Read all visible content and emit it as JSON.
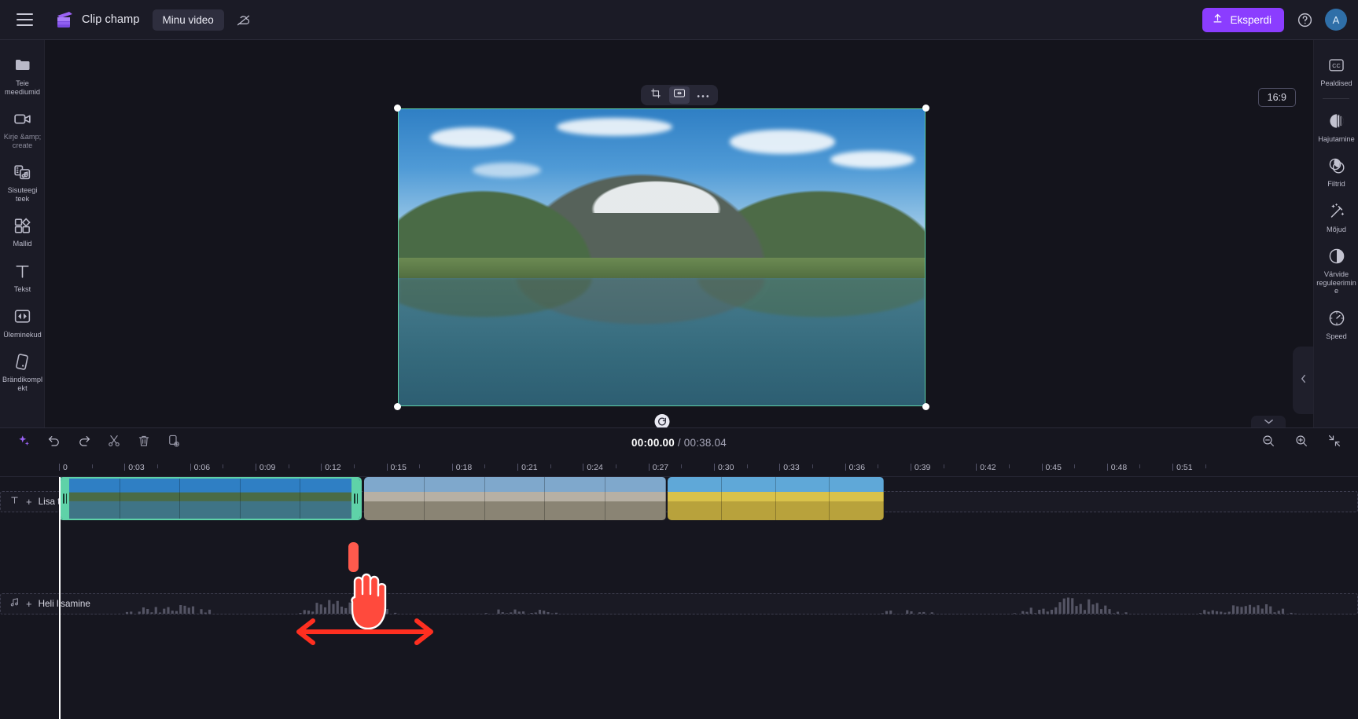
{
  "app": {
    "brand_name": "Clip champ",
    "project_name": "Minu video"
  },
  "topbar": {
    "menu_icon": "hamburger-icon",
    "logo_icon": "clipchamp-logo-icon",
    "cloud_off_icon": "cloud-off-icon",
    "export_label": "Eksperdi",
    "export_icon": "upload-icon",
    "help_icon": "help-circle-icon",
    "avatar_initial": "A",
    "accent_color": "#8b3dff"
  },
  "sidebar_left": {
    "items": [
      {
        "label": "Teie meediumid",
        "icon": "folder-icon"
      },
      {
        "label": "Kirje &amp; create",
        "icon": "video-camera-icon"
      },
      {
        "label": "Sisuteegi teek",
        "icon": "media-library-icon"
      },
      {
        "label": "Mallid",
        "icon": "templates-icon"
      },
      {
        "label": "Tekst",
        "icon": "text-icon"
      },
      {
        "label": "Üleminekud",
        "icon": "transitions-icon"
      },
      {
        "label": "Brändikomplekt",
        "icon": "brand-kit-icon"
      }
    ]
  },
  "sidebar_right": {
    "items": [
      {
        "label": "Pealdised",
        "icon": "closed-captions-icon"
      },
      {
        "label": "Hajutamine",
        "icon": "fade-icon"
      },
      {
        "label": "Filtrid",
        "icon": "filters-icon"
      },
      {
        "label": "Mõjud",
        "icon": "effects-wand-icon"
      },
      {
        "label": "Värvide reguleerimine",
        "icon": "color-adjust-icon"
      },
      {
        "label": "Speed",
        "icon": "speed-gauge-icon"
      }
    ],
    "collapse_icon": "chevron-left-icon"
  },
  "stage": {
    "float_toolbar": [
      {
        "name": "crop-button",
        "icon": "crop-icon"
      },
      {
        "name": "fit-button",
        "icon": "fit-horizontal-icon"
      },
      {
        "name": "more-options-button",
        "icon": "ellipsis-icon"
      }
    ],
    "aspect_ratio": "16:9",
    "rotate_icon": "rotate-icon",
    "selection_color": "#5fd2a8"
  },
  "preview_controls": {
    "subtitle_off_icon": "subtitles-off-icon",
    "skip_prev_icon": "skip-previous-icon",
    "back5_icon": "rewind-5-icon",
    "play_icon": "play-icon",
    "fwd5_icon": "forward-5-icon",
    "skip_next_icon": "skip-next-icon",
    "fullscreen_icon": "fullscreen-icon"
  },
  "timeline": {
    "tools": [
      {
        "name": "ai-suggest-button",
        "icon": "sparkle-icon"
      },
      {
        "name": "undo-button",
        "icon": "undo-icon"
      },
      {
        "name": "redo-button",
        "icon": "redo-icon"
      },
      {
        "name": "split-button",
        "icon": "scissors-icon"
      },
      {
        "name": "delete-button",
        "icon": "trash-icon"
      },
      {
        "name": "duplicate-button",
        "icon": "duplicate-icon"
      }
    ],
    "current_time": "00:00.00",
    "total_time": "/ 00:38.04",
    "zoom_out_icon": "zoom-out-icon",
    "zoom_in_icon": "zoom-in-icon",
    "fit-timeline_icon": "fit-timeline-icon",
    "collapse_icon": "chevron-down-icon",
    "ruler_labels": [
      "0",
      "0:03",
      "0:06",
      "0:09",
      "0:12",
      "0:15",
      "0:18",
      "0:21",
      "0:24",
      "0:27",
      "0:30",
      "0:33",
      "0:36",
      "0:39",
      "0:42",
      "0:45",
      "0:48",
      "0:51"
    ],
    "text_track": {
      "label": "Lisa tekst",
      "icon": "text-t-icon",
      "plus": "+"
    },
    "audio_track": {
      "label": "Heli lisamine",
      "icon": "music-note-icon",
      "plus": "+"
    },
    "clips": [
      {
        "name": "video-clip-1",
        "selected": true
      },
      {
        "name": "video-clip-2",
        "selected": false
      },
      {
        "name": "video-clip-3",
        "selected": false
      }
    ]
  },
  "annotation": {
    "cursor": "hand-cursor",
    "arrow": "drag-horizontal-arrow",
    "arrow_color": "#ff3b2f"
  }
}
